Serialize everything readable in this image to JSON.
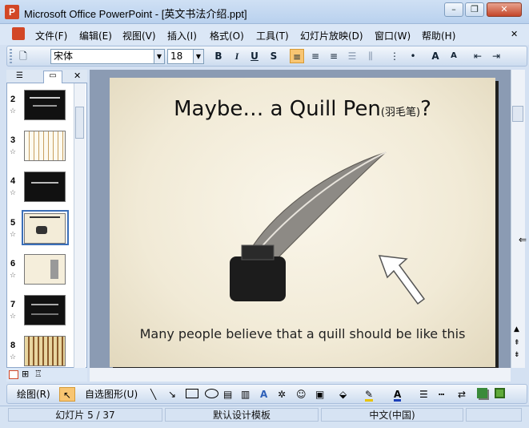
{
  "window": {
    "title": "Microsoft Office PowerPoint - [英文书法介绍.ppt]",
    "app_icon": "P",
    "min": "–",
    "restore": "❐",
    "close": "✕"
  },
  "menu": [
    "文件(F)",
    "编辑(E)",
    "视图(V)",
    "插入(I)",
    "格式(O)",
    "工具(T)",
    "幻灯片放映(D)",
    "窗口(W)",
    "帮助(H)"
  ],
  "toolbar": {
    "font": "宋体",
    "size": "18",
    "bold": "B",
    "italic": "I",
    "underline": "U",
    "shadow": "S"
  },
  "thumbnails": [
    {
      "num": "2"
    },
    {
      "num": "3"
    },
    {
      "num": "4"
    },
    {
      "num": "5"
    },
    {
      "num": "6"
    },
    {
      "num": "7"
    },
    {
      "num": "8"
    }
  ],
  "slide": {
    "title": "Maybe… a Quill Pen",
    "title_cn": "(羽毛笔)",
    "title_end": "?",
    "caption": "Many people believe that a quill should be like this"
  },
  "drawbar": {
    "draw": "绘图(R)",
    "autoshape": "自选图形(U)"
  },
  "status": {
    "slide": "幻灯片 5 / 37",
    "template": "默认设计模板",
    "language": "中文(中国)"
  },
  "colors": {
    "accent": "#d24726",
    "chrome": "#dbe7f6"
  },
  "icons": [
    "app-icon",
    "new-doc-icon",
    "align-left-icon",
    "center-icon",
    "align-right-icon",
    "bullets-icon",
    "numbering-icon",
    "grow-font-icon",
    "shrink-font-icon",
    "cursor-icon",
    "line-icon",
    "arrow-icon",
    "rectangle-icon",
    "oval-icon",
    "textbox-icon",
    "wordart-icon",
    "fill-color-icon",
    "line-color-icon",
    "font-color-icon",
    "shadow-icon",
    "3d-icon"
  ]
}
